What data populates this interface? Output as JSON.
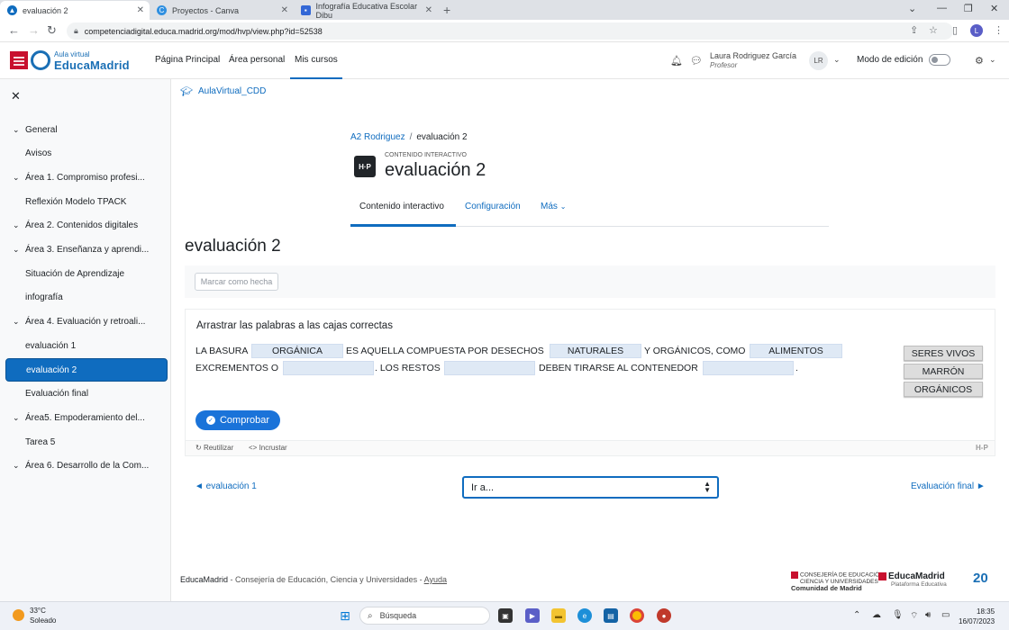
{
  "browser": {
    "tabs": [
      {
        "title": "evaluación 2",
        "active": true
      },
      {
        "title": "Proyectos - Canva",
        "active": false
      },
      {
        "title": "Infografía Educativa Escolar Dibu",
        "active": false
      }
    ],
    "url": "competenciadigital.educa.madrid.org/mod/hvp/view.php?id=52538",
    "profile_initial": "L"
  },
  "header": {
    "logo_small": "Aula virtual",
    "logo_big": "EducaMadrid",
    "nav": [
      "Página Principal",
      "Área personal",
      "Mis cursos"
    ],
    "user_name": "Laura Rodriguez García",
    "user_role": "Profesor",
    "avatar_initials": "LR",
    "edit_mode_label": "Modo de edición"
  },
  "sidebar": {
    "items": [
      {
        "label": "General",
        "type": "section"
      },
      {
        "label": "Avisos",
        "type": "sub"
      },
      {
        "label": "Área 1. Compromiso profesi...",
        "type": "section"
      },
      {
        "label": "Reflexión Modelo TPACK",
        "type": "sub"
      },
      {
        "label": "Área 2. Contenidos digitales",
        "type": "section"
      },
      {
        "label": "Área 3. Enseñanza y aprendi...",
        "type": "section"
      },
      {
        "label": "Situación de Aprendizaje",
        "type": "sub"
      },
      {
        "label": "infografía",
        "type": "sub"
      },
      {
        "label": "Área 4. Evaluación y retroali...",
        "type": "section"
      },
      {
        "label": "evaluación 1",
        "type": "sub"
      },
      {
        "label": "evaluación 2",
        "type": "current"
      },
      {
        "label": "Evaluación final",
        "type": "sub"
      },
      {
        "label": "Área5. Empoderamiento del...",
        "type": "section"
      },
      {
        "label": "Tarea 5",
        "type": "sub"
      },
      {
        "label": "Área 6. Desarrollo de la Com...",
        "type": "section"
      }
    ]
  },
  "main": {
    "course_short": "AulaVirtual_CDD",
    "breadcrumb": [
      "A2 Rodriguez",
      "evaluación 2"
    ],
    "content_type": "CONTENIDO INTERACTIVO",
    "page_title": "evaluación 2",
    "secondary_nav": [
      "Contenido interactivo",
      "Configuración",
      "Más"
    ],
    "activity_title": "evaluación 2",
    "mark_done_label": "Marcar como hecha"
  },
  "h5p": {
    "task": "Arrastrar las palabras a las cajas correctas",
    "line1": {
      "t1": "LA BASURA",
      "d1": "ORGÁNICA",
      "t2": "ES AQUELLA COMPUESTA POR DESECHOS",
      "d2": "NATURALES",
      "t3": "Y ORGÁNICOS, COMO",
      "d3": "ALIMENTOS"
    },
    "line2": {
      "t1": "EXCREMENTOS O",
      "d1": "",
      "t2": ". LOS RESTOS",
      "d2": "",
      "t3": "DEBEN TIRARSE AL CONTENEDOR",
      "d3": "",
      "t4": "."
    },
    "draggables": [
      "SERES VIVOS",
      "MARRÓN",
      "ORGÁNICOS"
    ],
    "check_label": "Comprobar",
    "footer_reuse": "Reutilizar",
    "footer_embed": "Incrustar",
    "footer_brand": "H-P"
  },
  "activity_nav": {
    "prev": "◄ evaluación 1",
    "jump_placeholder": "Ir a...",
    "next": "Evaluación final ►"
  },
  "footer": {
    "brand": "EducaMadrid",
    "text": " - Consejería de Educación, Ciencia y Universidades - ",
    "help": "Ayuda",
    "logo1_line1": "CONSEJERÍA DE EDUCACIÓN",
    "logo1_line2": "CIENCIA Y UNIVERSIDADES",
    "logo1_line3": "Comunidad de Madrid",
    "logo2": "EducaMadrid",
    "logo2_sub": "Plataforma Educativa",
    "logo3": "20"
  },
  "taskbar": {
    "temp": "33°C",
    "weather": "Soleado",
    "search": "Búsqueda",
    "time": "18:35",
    "date": "16/07/2023"
  },
  "colors": {
    "primary": "#0f6cbf",
    "h5p_check": "#1a73d9",
    "dropzone": "#dfe9f5"
  }
}
